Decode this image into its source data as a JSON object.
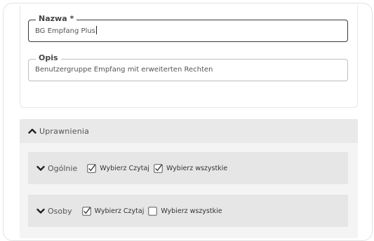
{
  "form": {
    "name_field": {
      "label": "Nazwa *",
      "value": "BG Empfang Plus"
    },
    "description_field": {
      "label": "Opis",
      "value": "Benutzergruppe Empfang mit erweiterten Rechten"
    }
  },
  "permissions": {
    "title": "Uprawnienia",
    "expanded": true,
    "groups": [
      {
        "title": "Ogólnie",
        "expanded": false,
        "read_label": "Wybierz Czytaj",
        "read_checked": true,
        "all_label": "Wybierz wszystkie",
        "all_checked": true
      },
      {
        "title": "Osoby",
        "expanded": false,
        "read_label": "Wybierz Czytaj",
        "read_checked": true,
        "all_label": "Wybierz wszystkie",
        "all_checked": false
      }
    ]
  },
  "icons": {
    "expand": "chevron-up-icon",
    "collapse": "chevron-down-icon",
    "checked": "checkbox-checked-icon",
    "unchecked": "checkbox-unchecked-icon"
  },
  "colors": {
    "section_header": "#e9e9e9",
    "group_background": "#e6e6e6",
    "focused_border": "#3a3a3a"
  }
}
